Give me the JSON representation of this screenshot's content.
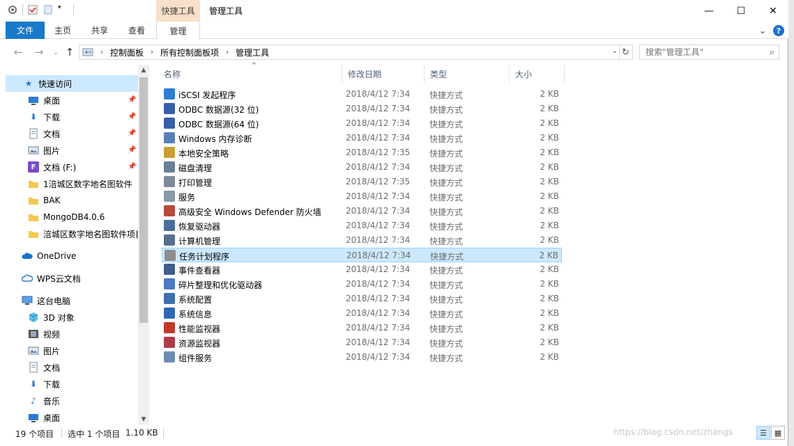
{
  "titlebar": {
    "title": "管理工具",
    "context_tab": "快捷工具",
    "minimize": "—",
    "maximize": "☐",
    "close": "✕"
  },
  "ribbon": {
    "tabs": [
      "文件",
      "主页",
      "共享",
      "查看",
      "管理"
    ],
    "collapse": "⌄",
    "help": "?"
  },
  "address": {
    "back": "←",
    "forward": "→",
    "recent": "⌄",
    "up": "↑",
    "crumbs": [
      "控制面板",
      "所有控制面板项",
      "管理工具"
    ],
    "search_placeholder": "搜索\"管理工具\""
  },
  "navpane": {
    "quick_access": "快速访问",
    "pinned": [
      {
        "label": "桌面",
        "icon": "desktop-icon"
      },
      {
        "label": "下载",
        "icon": "download-icon"
      },
      {
        "label": "文档",
        "icon": "document-icon"
      },
      {
        "label": "图片",
        "icon": "picture-icon"
      },
      {
        "label": "文档 (F:)",
        "icon": "drive-icon"
      }
    ],
    "folders": [
      "1涪城区数字地名图软件",
      "BAK",
      "MongoDB4.0.6",
      "涪城区数字地名图软件项目"
    ],
    "onedrive": "OneDrive",
    "wps": "WPS云文档",
    "this_pc": "这台电脑",
    "pc_items": [
      "3D 对象",
      "视频",
      "图片",
      "文档",
      "下载",
      "音乐",
      "桌面"
    ]
  },
  "columns": {
    "name": "名称",
    "modified": "修改日期",
    "type": "类型",
    "size": "大小"
  },
  "files": [
    {
      "name": "iSCSI 发起程序",
      "date": "2018/4/12 7:34",
      "type": "快捷方式",
      "size": "2 KB",
      "color": "#2d7fd3"
    },
    {
      "name": "ODBC 数据源(32 位)",
      "date": "2018/4/12 7:34",
      "type": "快捷方式",
      "size": "2 KB",
      "color": "#3a5fa8"
    },
    {
      "name": "ODBC 数据源(64 位)",
      "date": "2018/4/12 7:34",
      "type": "快捷方式",
      "size": "2 KB",
      "color": "#3a5fa8"
    },
    {
      "name": "Windows 内存诊断",
      "date": "2018/4/12 7:34",
      "type": "快捷方式",
      "size": "2 KB",
      "color": "#5a7fb8"
    },
    {
      "name": "本地安全策略",
      "date": "2018/4/12 7:35",
      "type": "快捷方式",
      "size": "2 KB",
      "color": "#c9a033"
    },
    {
      "name": "磁盘清理",
      "date": "2018/4/12 7:34",
      "type": "快捷方式",
      "size": "2 KB",
      "color": "#6b7f95"
    },
    {
      "name": "打印管理",
      "date": "2018/4/12 7:35",
      "type": "快捷方式",
      "size": "2 KB",
      "color": "#7d8a99"
    },
    {
      "name": "服务",
      "date": "2018/4/12 7:34",
      "type": "快捷方式",
      "size": "2 KB",
      "color": "#8a9aa8"
    },
    {
      "name": "高级安全 Windows Defender 防火墙",
      "date": "2018/4/12 7:34",
      "type": "快捷方式",
      "size": "2 KB",
      "color": "#b84a3a"
    },
    {
      "name": "恢复驱动器",
      "date": "2018/4/12 7:34",
      "type": "快捷方式",
      "size": "2 KB",
      "color": "#4a6d9c"
    },
    {
      "name": "计算机管理",
      "date": "2018/4/12 7:34",
      "type": "快捷方式",
      "size": "2 KB",
      "color": "#55708f"
    },
    {
      "name": "任务计划程序",
      "date": "2018/4/12 7:34",
      "type": "快捷方式",
      "size": "2 KB",
      "color": "#8e8e8e"
    },
    {
      "name": "事件查看器",
      "date": "2018/4/12 7:34",
      "type": "快捷方式",
      "size": "2 KB",
      "color": "#3f5f8a"
    },
    {
      "name": "碎片整理和优化驱动器",
      "date": "2018/4/12 7:34",
      "type": "快捷方式",
      "size": "2 KB",
      "color": "#4a7ac4"
    },
    {
      "name": "系统配置",
      "date": "2018/4/12 7:34",
      "type": "快捷方式",
      "size": "2 KB",
      "color": "#3f6fae"
    },
    {
      "name": "系统信息",
      "date": "2018/4/12 7:34",
      "type": "快捷方式",
      "size": "2 KB",
      "color": "#2f67b8"
    },
    {
      "name": "性能监视器",
      "date": "2018/4/12 7:34",
      "type": "快捷方式",
      "size": "2 KB",
      "color": "#c0392b"
    },
    {
      "name": "资源监视器",
      "date": "2018/4/12 7:34",
      "type": "快捷方式",
      "size": "2 KB",
      "color": "#b03a48"
    },
    {
      "name": "组件服务",
      "date": "2018/4/12 7:34",
      "type": "快捷方式",
      "size": "2 KB",
      "color": "#6e8cb0"
    }
  ],
  "selected_index": 11,
  "statusbar": {
    "count": "19 个项目",
    "selection": "选中 1 个项目",
    "size": "1.10 KB"
  },
  "watermark": "https://blog.csdn.net/zhangs"
}
